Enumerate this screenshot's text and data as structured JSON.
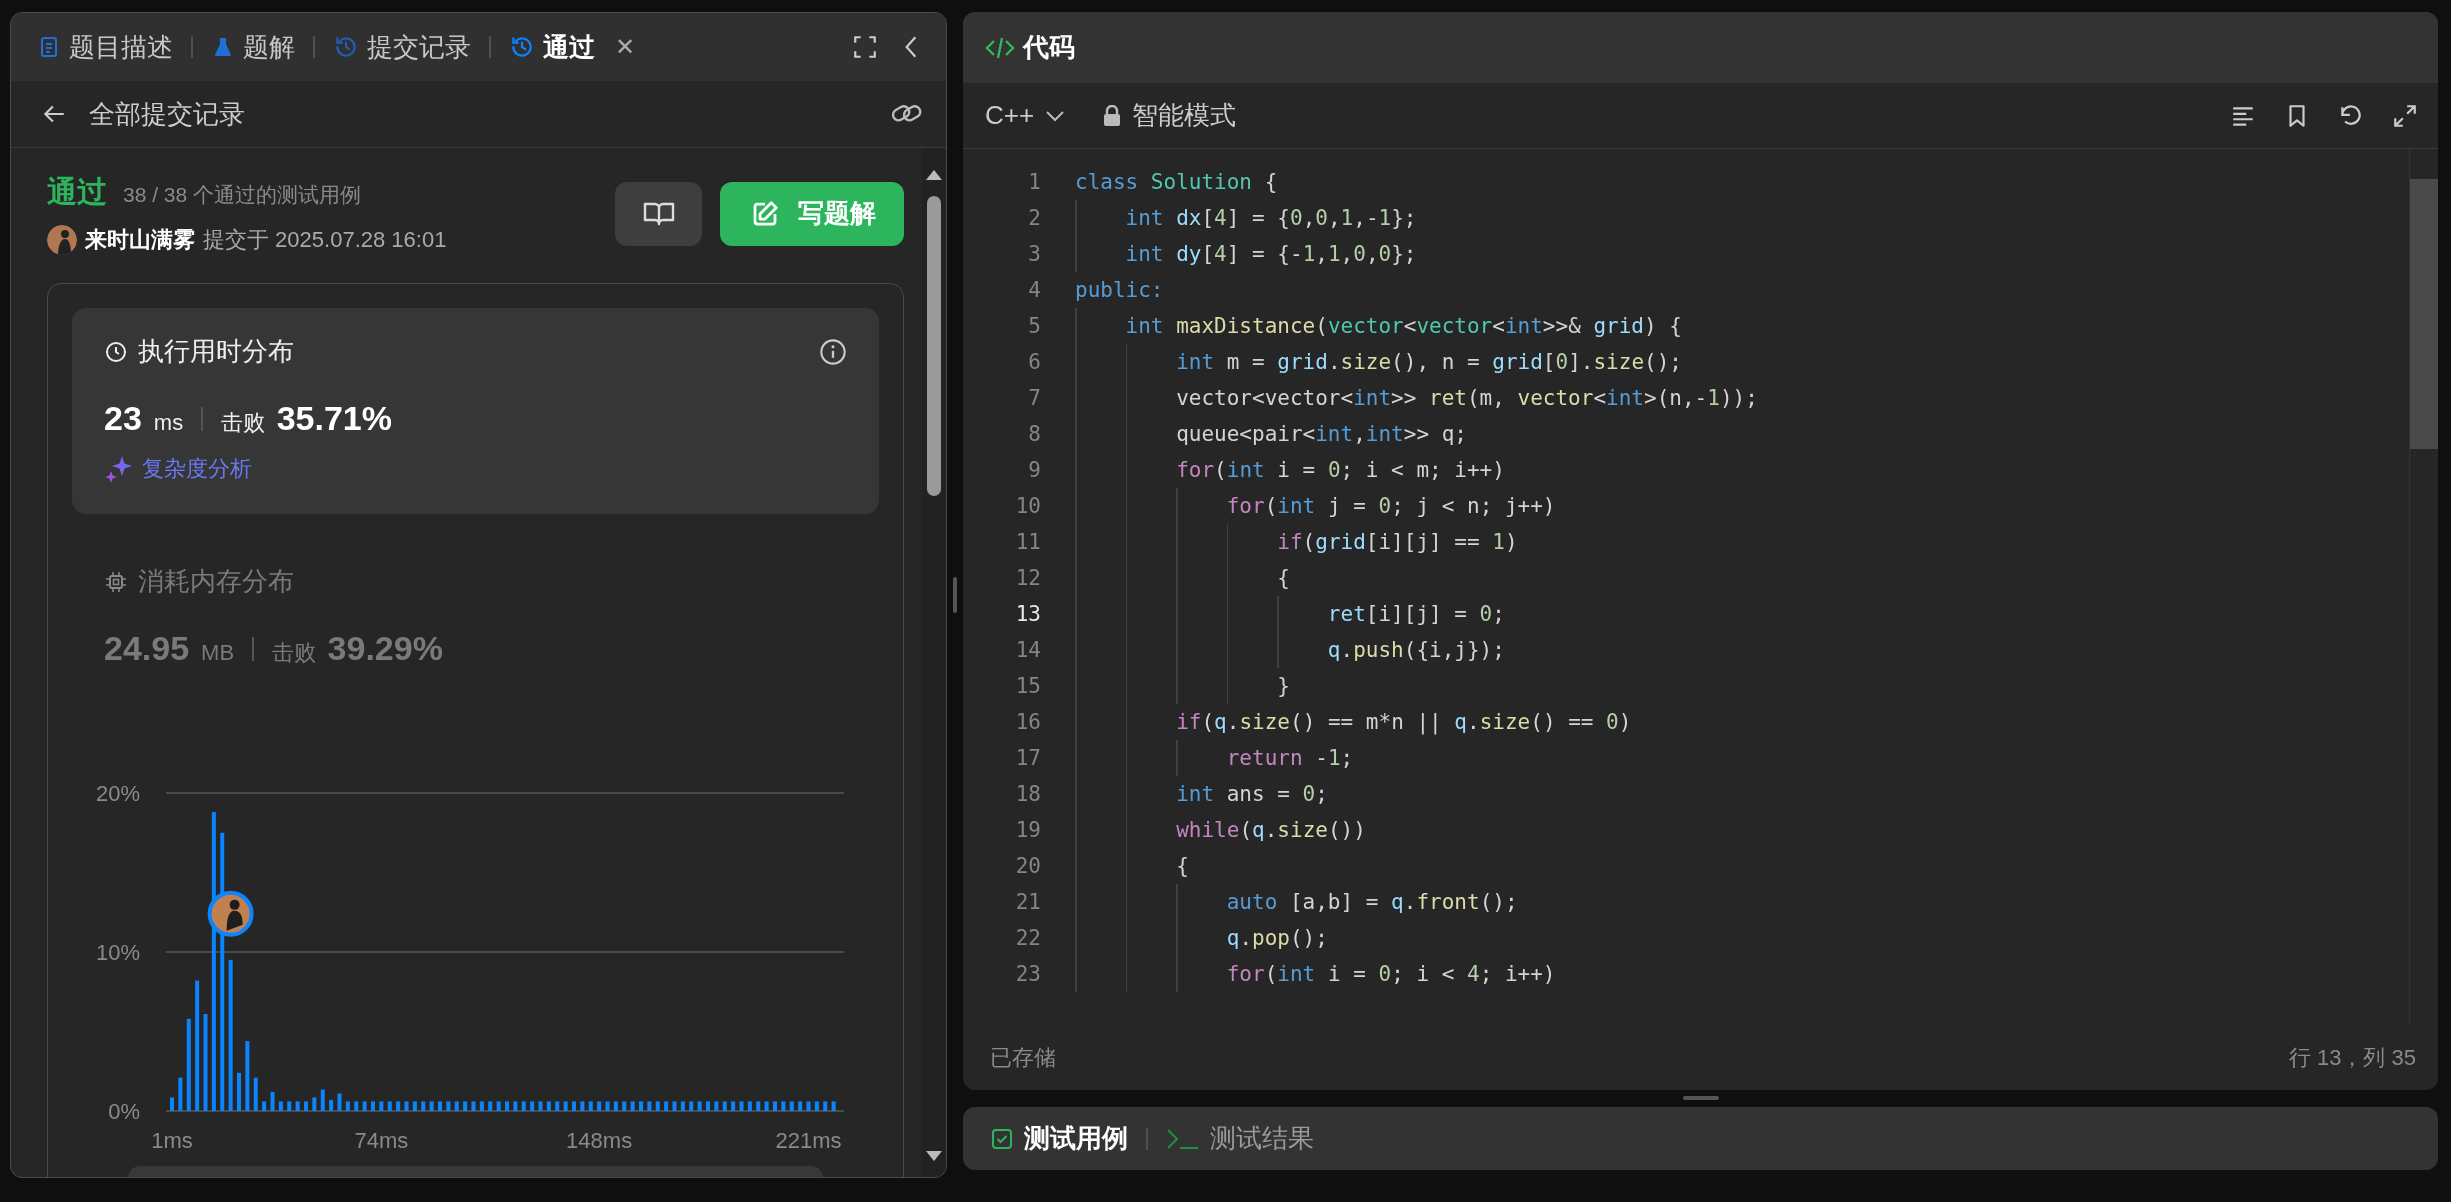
{
  "left_panel": {
    "tabs": [
      {
        "label": "题目描述",
        "kind": "document",
        "selected": false
      },
      {
        "label": "题解",
        "kind": "flask",
        "selected": false
      },
      {
        "label": "提交记录",
        "kind": "history",
        "selected": false
      },
      {
        "label": "通过",
        "kind": "history",
        "selected": true
      }
    ],
    "close_glyph": "✕",
    "back_label": "全部提交记录",
    "submission": {
      "status": "通过",
      "summary": "38 / 38 个通过的测试用例",
      "author": "来时山满雾",
      "submitted": "提交于 2025.07.28 16:01",
      "write_button": "写题解"
    },
    "stats": [
      {
        "kind": "runtime",
        "title": "执行用时分布",
        "value": "23",
        "unit": "ms",
        "beat_label": "击败",
        "beat": "35.71%",
        "selected": true,
        "link": "复杂度分析"
      },
      {
        "kind": "memory",
        "title": "消耗内存分布",
        "value": "24.95",
        "unit": "MB",
        "beat_label": "击败",
        "beat": "39.29%",
        "selected": false
      }
    ],
    "chart_data": {
      "type": "bar",
      "ylim": [
        0,
        20
      ],
      "yticks": [
        {
          "value": 0,
          "label": "0%"
        },
        {
          "value": 10,
          "label": "10%"
        },
        {
          "value": 20,
          "label": "20%"
        }
      ],
      "categories": [
        "1ms",
        null,
        null,
        null,
        null,
        null,
        null,
        null,
        null,
        null,
        null,
        null,
        null,
        null,
        null,
        null,
        null,
        null,
        null,
        null,
        null,
        null,
        null,
        null,
        null,
        "74ms",
        null,
        null,
        null,
        null,
        null,
        null,
        null,
        null,
        null,
        null,
        null,
        null,
        null,
        null,
        null,
        null,
        null,
        null,
        null,
        null,
        null,
        null,
        null,
        null,
        null,
        "148ms",
        null,
        null,
        null,
        null,
        null,
        null,
        null,
        null,
        null,
        null,
        null,
        null,
        null,
        null,
        null,
        null,
        null,
        null,
        null,
        null,
        null,
        null,
        null,
        null,
        "221ms",
        null,
        null,
        null
      ],
      "series": [
        {
          "color": "#0a84ff",
          "values": [
            0.85,
            2.1,
            5.8,
            8.2,
            6.1,
            18.8,
            17.5,
            9.5,
            2.4,
            4.4,
            2.1,
            0.6,
            1.2,
            0.6,
            0.6,
            0.6,
            0.6,
            0.85,
            1.35,
            0.7,
            1.1,
            0.6,
            0.6,
            0.6,
            0.6,
            0.6,
            0.6,
            0.6,
            0.6,
            0.6,
            0.6,
            0.6,
            0.6,
            0.6,
            0.6,
            0.6,
            0.6,
            0.6,
            0.6,
            0.6,
            0.6,
            0.6,
            0.6,
            0.6,
            0.6,
            0.6,
            0.6,
            0.6,
            0.6,
            0.6,
            0.6,
            0.6,
            0.6,
            0.6,
            0.6,
            0.6,
            0.6,
            0.6,
            0.6,
            0.6,
            0.6,
            0.6,
            0.6,
            0.6,
            0.6,
            0.6,
            0.6,
            0.6,
            0.6,
            0.6,
            0.6,
            0.6,
            0.6,
            0.6,
            0.6,
            0.6,
            0.6,
            0.6,
            0.6,
            0.6
          ]
        }
      ]
    }
  },
  "editor": {
    "title": "代码",
    "language": "C++",
    "mode": "智能模式",
    "status": "已存储",
    "cursor": "行 13，列 35",
    "lines": [
      {
        "number": "1",
        "current": false,
        "tokens": [
          {
            "text": "class",
            "kind": "keyword"
          },
          {
            "text": " Solution",
            "kind": "type"
          },
          {
            "text": " {",
            "kind": "plain"
          }
        ]
      },
      {
        "number": "2",
        "current": false,
        "tokens": [
          {
            "text": "    int",
            "kind": "keyword"
          },
          {
            "text": " dx",
            "kind": "variable"
          },
          {
            "text": "[",
            "kind": "plain"
          },
          {
            "text": "4",
            "kind": "number"
          },
          {
            "text": "] = {",
            "kind": "plain"
          },
          {
            "text": "0",
            "kind": "number"
          },
          {
            "text": ",",
            "kind": "plain"
          },
          {
            "text": "0",
            "kind": "number"
          },
          {
            "text": ",",
            "kind": "plain"
          },
          {
            "text": "1",
            "kind": "number"
          },
          {
            "text": ",-",
            "kind": "plain"
          },
          {
            "text": "1",
            "kind": "number"
          },
          {
            "text": "};",
            "kind": "plain"
          }
        ]
      },
      {
        "number": "3",
        "current": false,
        "tokens": [
          {
            "text": "    int",
            "kind": "keyword"
          },
          {
            "text": " dy",
            "kind": "variable"
          },
          {
            "text": "[",
            "kind": "plain"
          },
          {
            "text": "4",
            "kind": "number"
          },
          {
            "text": "] = {-",
            "kind": "plain"
          },
          {
            "text": "1",
            "kind": "number"
          },
          {
            "text": ",",
            "kind": "plain"
          },
          {
            "text": "1",
            "kind": "number"
          },
          {
            "text": ",",
            "kind": "plain"
          },
          {
            "text": "0",
            "kind": "number"
          },
          {
            "text": ",",
            "kind": "plain"
          },
          {
            "text": "0",
            "kind": "number"
          },
          {
            "text": "};",
            "kind": "plain"
          }
        ]
      },
      {
        "number": "4",
        "current": false,
        "tokens": [
          {
            "text": "public:",
            "kind": "keyword"
          }
        ]
      },
      {
        "number": "5",
        "current": false,
        "tokens": [
          {
            "text": "    int",
            "kind": "keyword"
          },
          {
            "text": " maxDistance",
            "kind": "function"
          },
          {
            "text": "(",
            "kind": "plain"
          },
          {
            "text": "vector",
            "kind": "type"
          },
          {
            "text": "<",
            "kind": "plain"
          },
          {
            "text": "vector",
            "kind": "type"
          },
          {
            "text": "<",
            "kind": "plain"
          },
          {
            "text": "int",
            "kind": "keyword"
          },
          {
            "text": ">>&",
            "kind": "plain"
          },
          {
            "text": " grid",
            "kind": "variable"
          },
          {
            "text": ") {",
            "kind": "plain"
          }
        ]
      },
      {
        "number": "6",
        "current": false,
        "tokens": [
          {
            "text": "        int",
            "kind": "keyword"
          },
          {
            "text": " m =",
            "kind": "plain"
          },
          {
            "text": " grid",
            "kind": "variable"
          },
          {
            "text": ".",
            "kind": "plain"
          },
          {
            "text": "size",
            "kind": "function"
          },
          {
            "text": "(), n =",
            "kind": "plain"
          },
          {
            "text": " grid",
            "kind": "variable"
          },
          {
            "text": "[",
            "kind": "plain"
          },
          {
            "text": "0",
            "kind": "number"
          },
          {
            "text": "].",
            "kind": "plain"
          },
          {
            "text": "size",
            "kind": "function"
          },
          {
            "text": "();",
            "kind": "plain"
          }
        ]
      },
      {
        "number": "7",
        "current": false,
        "tokens": [
          {
            "text": "        vector<vector<",
            "kind": "plain"
          },
          {
            "text": "int",
            "kind": "keyword"
          },
          {
            "text": ">>",
            "kind": "plain"
          },
          {
            "text": " ret",
            "kind": "function"
          },
          {
            "text": "(m,",
            "kind": "plain"
          },
          {
            "text": " vector",
            "kind": "function"
          },
          {
            "text": "<",
            "kind": "plain"
          },
          {
            "text": "int",
            "kind": "keyword"
          },
          {
            "text": ">(n,-",
            "kind": "plain"
          },
          {
            "text": "1",
            "kind": "number"
          },
          {
            "text": "));",
            "kind": "plain"
          }
        ]
      },
      {
        "number": "8",
        "current": false,
        "tokens": [
          {
            "text": "        queue<pair<",
            "kind": "plain"
          },
          {
            "text": "int",
            "kind": "keyword"
          },
          {
            "text": ",",
            "kind": "plain"
          },
          {
            "text": "int",
            "kind": "keyword"
          },
          {
            "text": ">> q;",
            "kind": "plain"
          }
        ]
      },
      {
        "number": "9",
        "current": false,
        "tokens": [
          {
            "text": "        for",
            "kind": "control"
          },
          {
            "text": "(",
            "kind": "plain"
          },
          {
            "text": "int",
            "kind": "keyword"
          },
          {
            "text": " i =",
            "kind": "plain"
          },
          {
            "text": " 0",
            "kind": "number"
          },
          {
            "text": "; i < m; i++)",
            "kind": "plain"
          }
        ]
      },
      {
        "number": "10",
        "current": false,
        "tokens": [
          {
            "text": "            for",
            "kind": "control"
          },
          {
            "text": "(",
            "kind": "plain"
          },
          {
            "text": "int",
            "kind": "keyword"
          },
          {
            "text": " j =",
            "kind": "plain"
          },
          {
            "text": " 0",
            "kind": "number"
          },
          {
            "text": "; j < n; j++)",
            "kind": "plain"
          }
        ]
      },
      {
        "number": "11",
        "current": false,
        "tokens": [
          {
            "text": "                if",
            "kind": "control"
          },
          {
            "text": "(",
            "kind": "plain"
          },
          {
            "text": "grid",
            "kind": "variable"
          },
          {
            "text": "[i][j] ==",
            "kind": "plain"
          },
          {
            "text": " 1",
            "kind": "number"
          },
          {
            "text": ")",
            "kind": "plain"
          }
        ]
      },
      {
        "number": "12",
        "current": false,
        "tokens": [
          {
            "text": "                {",
            "kind": "plain"
          }
        ]
      },
      {
        "number": "13",
        "current": true,
        "tokens": [
          {
            "text": "                    ret",
            "kind": "variable"
          },
          {
            "text": "[i][j] =",
            "kind": "plain"
          },
          {
            "text": " 0",
            "kind": "number"
          },
          {
            "text": ";",
            "kind": "plain"
          }
        ]
      },
      {
        "number": "14",
        "current": false,
        "tokens": [
          {
            "text": "                    q",
            "kind": "variable"
          },
          {
            "text": ".",
            "kind": "plain"
          },
          {
            "text": "push",
            "kind": "function"
          },
          {
            "text": "({i,j});",
            "kind": "plain"
          }
        ]
      },
      {
        "number": "15",
        "current": false,
        "tokens": [
          {
            "text": "                }",
            "kind": "plain"
          }
        ]
      },
      {
        "number": "16",
        "current": false,
        "tokens": [
          {
            "text": "        if",
            "kind": "control"
          },
          {
            "text": "(",
            "kind": "plain"
          },
          {
            "text": "q",
            "kind": "variable"
          },
          {
            "text": ".",
            "kind": "plain"
          },
          {
            "text": "size",
            "kind": "function"
          },
          {
            "text": "() == m*n ||",
            "kind": "plain"
          },
          {
            "text": " q",
            "kind": "variable"
          },
          {
            "text": ".",
            "kind": "plain"
          },
          {
            "text": "size",
            "kind": "function"
          },
          {
            "text": "() ==",
            "kind": "plain"
          },
          {
            "text": " 0",
            "kind": "number"
          },
          {
            "text": ")",
            "kind": "plain"
          }
        ]
      },
      {
        "number": "17",
        "current": false,
        "tokens": [
          {
            "text": "            return",
            "kind": "control"
          },
          {
            "text": " -",
            "kind": "plain"
          },
          {
            "text": "1",
            "kind": "number"
          },
          {
            "text": ";",
            "kind": "plain"
          }
        ]
      },
      {
        "number": "18",
        "current": false,
        "tokens": [
          {
            "text": "        int",
            "kind": "keyword"
          },
          {
            "text": " ans =",
            "kind": "plain"
          },
          {
            "text": " 0",
            "kind": "number"
          },
          {
            "text": ";",
            "kind": "plain"
          }
        ]
      },
      {
        "number": "19",
        "current": false,
        "tokens": [
          {
            "text": "        while",
            "kind": "control"
          },
          {
            "text": "(",
            "kind": "plain"
          },
          {
            "text": "q",
            "kind": "variable"
          },
          {
            "text": ".",
            "kind": "plain"
          },
          {
            "text": "size",
            "kind": "function"
          },
          {
            "text": "())",
            "kind": "plain"
          }
        ]
      },
      {
        "number": "20",
        "current": false,
        "tokens": [
          {
            "text": "        {",
            "kind": "plain"
          }
        ]
      },
      {
        "number": "21",
        "current": false,
        "tokens": [
          {
            "text": "            auto",
            "kind": "keyword"
          },
          {
            "text": " [a,b] =",
            "kind": "plain"
          },
          {
            "text": " q",
            "kind": "variable"
          },
          {
            "text": ".",
            "kind": "plain"
          },
          {
            "text": "front",
            "kind": "function"
          },
          {
            "text": "();",
            "kind": "plain"
          }
        ]
      },
      {
        "number": "22",
        "current": false,
        "tokens": [
          {
            "text": "            q",
            "kind": "variable"
          },
          {
            "text": ".",
            "kind": "plain"
          },
          {
            "text": "pop",
            "kind": "function"
          },
          {
            "text": "();",
            "kind": "plain"
          }
        ]
      },
      {
        "number": "23",
        "current": false,
        "tokens": [
          {
            "text": "            for",
            "kind": "control"
          },
          {
            "text": "(",
            "kind": "plain"
          },
          {
            "text": "int",
            "kind": "keyword"
          },
          {
            "text": " i =",
            "kind": "plain"
          },
          {
            "text": " 0",
            "kind": "number"
          },
          {
            "text": "; i <",
            "kind": "plain"
          },
          {
            "text": " 4",
            "kind": "number"
          },
          {
            "text": "; i++)",
            "kind": "plain"
          }
        ]
      }
    ]
  },
  "bottom_panel": {
    "tabs": [
      {
        "label": "测试用例",
        "kind": "check",
        "selected": true
      },
      {
        "label": "测试结果",
        "kind": "terminal",
        "selected": false
      }
    ]
  }
}
